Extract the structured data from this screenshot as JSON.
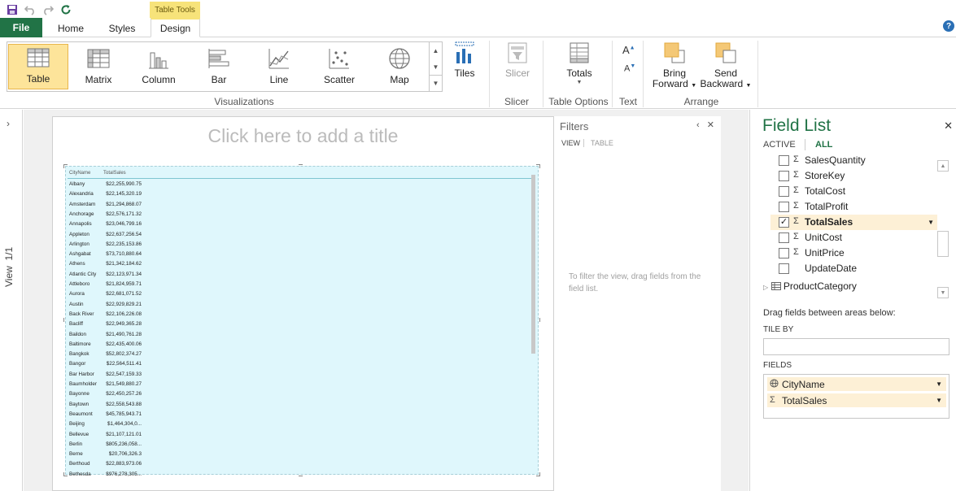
{
  "ribbon": {
    "context_tab_label": "Table Tools",
    "tabs": {
      "file": "File",
      "home": "Home",
      "styles": "Styles",
      "design": "Design"
    },
    "visualizations": [
      "Table",
      "Matrix",
      "Column",
      "Bar",
      "Line",
      "Scatter",
      "Map"
    ],
    "selected_visualization": "Table",
    "tiles_label": "Tiles",
    "slicer_label": "Slicer",
    "totals_label": "Totals",
    "bring_forward_label": [
      "Bring",
      "Forward"
    ],
    "send_backward_label": [
      "Send",
      "Backward"
    ],
    "groups": {
      "visualizations": "Visualizations",
      "slicer": "Slicer",
      "table_options": "Table Options",
      "text": "Text",
      "arrange": "Arrange"
    },
    "font_up": "A",
    "font_down": "A"
  },
  "left_strip": {
    "view_label": "View",
    "page_counter": "1/1"
  },
  "report": {
    "title_placeholder": "Click here to add a title",
    "table": {
      "columns": [
        "CityName",
        "TotalSales"
      ],
      "rows": [
        [
          "Albany",
          "$22,255,990.75"
        ],
        [
          "Alexandria",
          "$22,145,320.19"
        ],
        [
          "Amsterdam",
          "$21,294,868.07"
        ],
        [
          "Anchorage",
          "$22,576,171.32"
        ],
        [
          "Annapolis",
          "$23,046,799.16"
        ],
        [
          "Appleton",
          "$22,637,256.54"
        ],
        [
          "Arlington",
          "$22,235,153.86"
        ],
        [
          "Ashgabat",
          "$73,710,880.64"
        ],
        [
          "Athens",
          "$21,342,184.62"
        ],
        [
          "Atlantic City",
          "$22,123,971.34"
        ],
        [
          "Attleboro",
          "$21,824,959.71"
        ],
        [
          "Aurora",
          "$22,681,071.52"
        ],
        [
          "Austin",
          "$22,929,829.21"
        ],
        [
          "Back River",
          "$22,106,226.08"
        ],
        [
          "Bacliff",
          "$22,949,365.28"
        ],
        [
          "Baildon",
          "$21,490,761.28"
        ],
        [
          "Baltimore",
          "$22,435,400.06"
        ],
        [
          "Bangkok",
          "$52,802,374.27"
        ],
        [
          "Bangor",
          "$22,564,511.41"
        ],
        [
          "Bar Harbor",
          "$22,547,159.33"
        ],
        [
          "Baumholder",
          "$21,549,880.27"
        ],
        [
          "Bayonne",
          "$22,450,257.26"
        ],
        [
          "Baytown",
          "$22,558,543.88"
        ],
        [
          "Beaumont",
          "$45,785,943.71"
        ],
        [
          "Beijing",
          "$1,464,304,0..."
        ],
        [
          "Bellevue",
          "$21,107,121.01"
        ],
        [
          "Berlin",
          "$805,236,058..."
        ],
        [
          "Berne",
          "$20,706,326.3"
        ],
        [
          "Berthoud",
          "$22,883,973.06"
        ],
        [
          "Bethesda",
          "$976,278,305..."
        ]
      ]
    }
  },
  "filters": {
    "title": "Filters",
    "tab_view": "VIEW",
    "tab_table": "TABLE",
    "hint": "To filter the view, drag fields from the field list."
  },
  "field_list": {
    "title": "Field List",
    "tab_active": "ACTIVE",
    "tab_all": "ALL",
    "items": [
      {
        "name": "SalesQuantity",
        "checked": false,
        "sigma": true
      },
      {
        "name": "StoreKey",
        "checked": false,
        "sigma": true
      },
      {
        "name": "TotalCost",
        "checked": false,
        "sigma": true
      },
      {
        "name": "TotalProfit",
        "checked": false,
        "sigma": true
      },
      {
        "name": "TotalSales",
        "checked": true,
        "sigma": true
      },
      {
        "name": "UnitCost",
        "checked": false,
        "sigma": true
      },
      {
        "name": "UnitPrice",
        "checked": false,
        "sigma": true
      },
      {
        "name": "UpdateDate",
        "checked": false,
        "sigma": false
      }
    ],
    "next_table": "ProductCategory",
    "drag_hint": "Drag fields between areas below:",
    "tile_by_label": "TILE BY",
    "fields_label": "FIELDS",
    "fields": [
      {
        "name": "CityName",
        "icon": "globe-icon"
      },
      {
        "name": "TotalSales",
        "icon": "sigma-icon"
      }
    ]
  },
  "colors": {
    "accent": "#217346",
    "selected_fill": "#fde49a",
    "context_tab": "#f7e37a",
    "table_bg": "#dff7fc"
  }
}
